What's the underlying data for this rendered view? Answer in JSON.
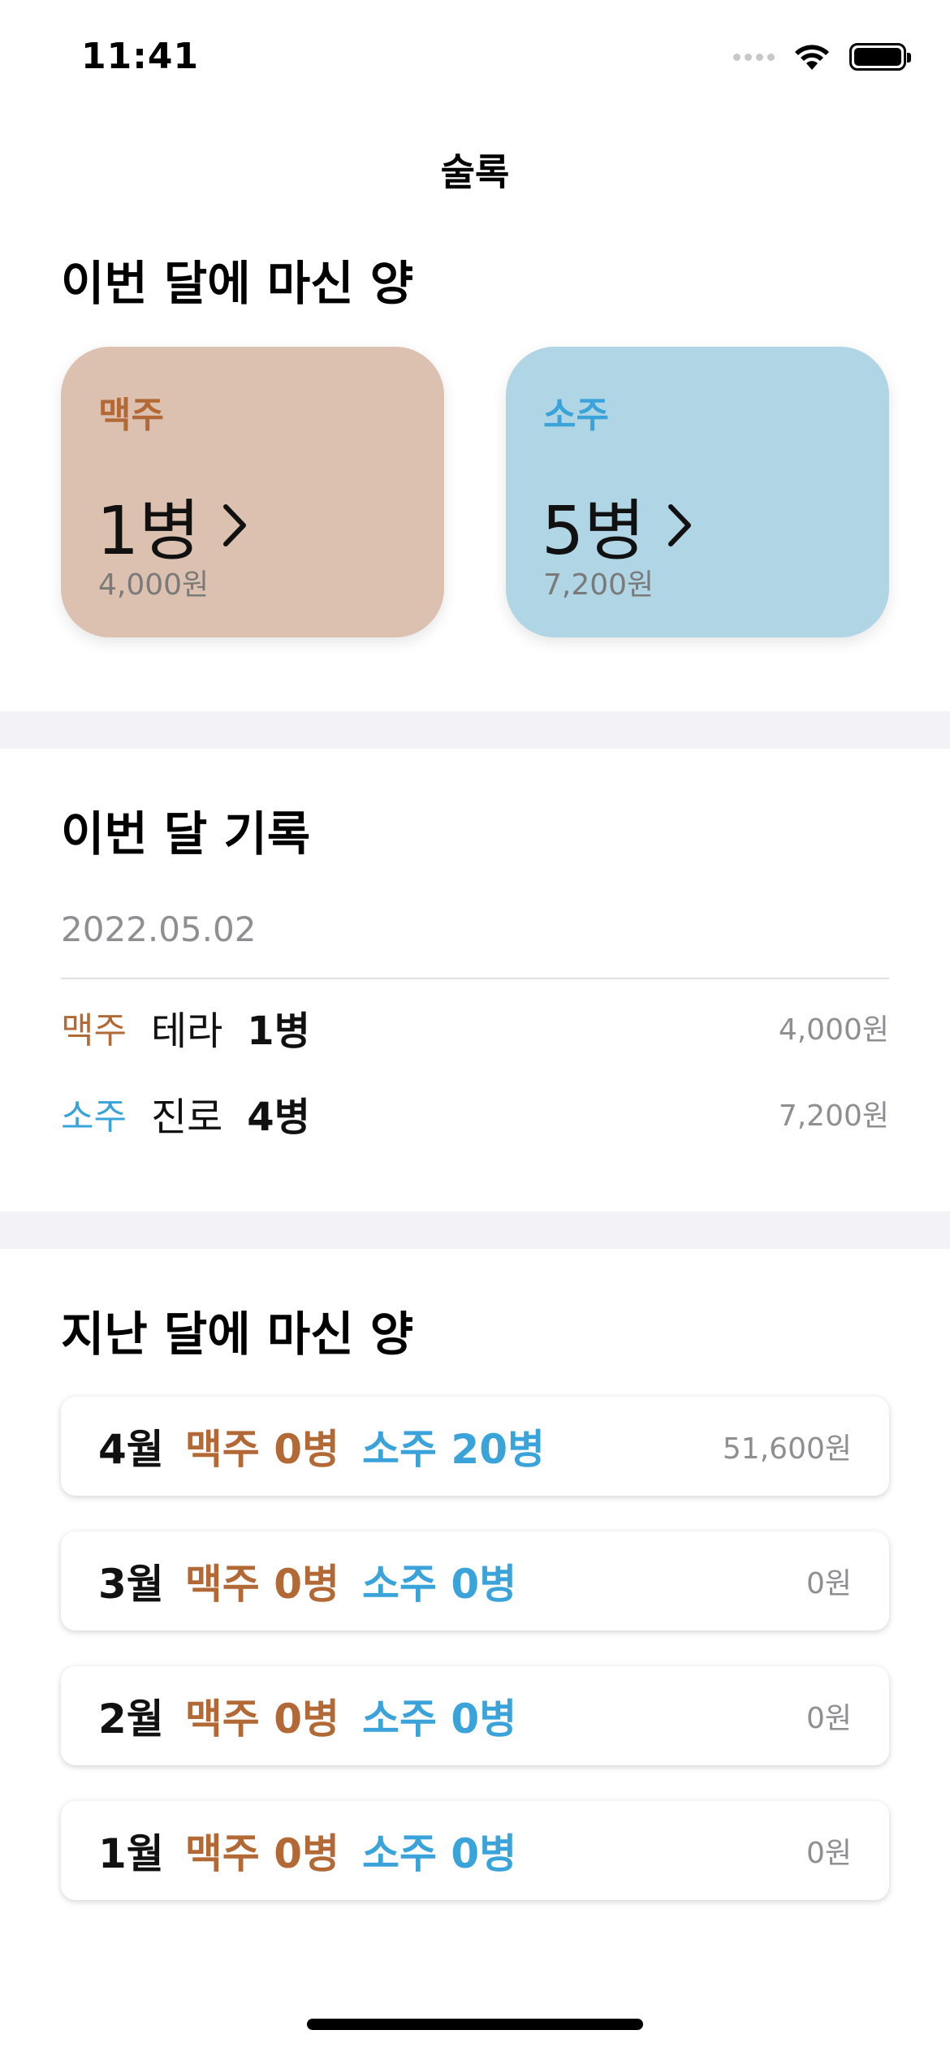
{
  "status_bar": {
    "time": "11:41"
  },
  "nav": {
    "title": "술록"
  },
  "this_month": {
    "title": "이번 달에 마신 양",
    "beer": {
      "kind": "맥주",
      "quantity": "1병",
      "amount": "4,000원"
    },
    "soju": {
      "kind": "소주",
      "quantity": "5병",
      "amount": "7,200원"
    }
  },
  "records": {
    "title": "이번 달 기록",
    "date": "2022.05.02",
    "items": [
      {
        "kind": "맥주",
        "name": "테라",
        "quantity": "1병",
        "price": "4,000원"
      },
      {
        "kind": "소주",
        "name": "진로",
        "quantity": "4병",
        "price": "7,200원"
      }
    ]
  },
  "last_months": {
    "title": "지난 달에 마신 양",
    "items": [
      {
        "month": "4월",
        "beer": "맥주 0병",
        "soju": "소주 20병",
        "total": "51,600원"
      },
      {
        "month": "3월",
        "beer": "맥주 0병",
        "soju": "소주 0병",
        "total": "0원"
      },
      {
        "month": "2월",
        "beer": "맥주 0병",
        "soju": "소주 0병",
        "total": "0원"
      },
      {
        "month": "1월",
        "beer": "맥주 0병",
        "soju": "소주 0병",
        "total": "0원"
      }
    ]
  },
  "colors": {
    "beer_accent": "#b26936",
    "soju_accent": "#3aa3d9",
    "beer_card": "#dcc1b1",
    "soju_card": "#b0d5e5"
  }
}
